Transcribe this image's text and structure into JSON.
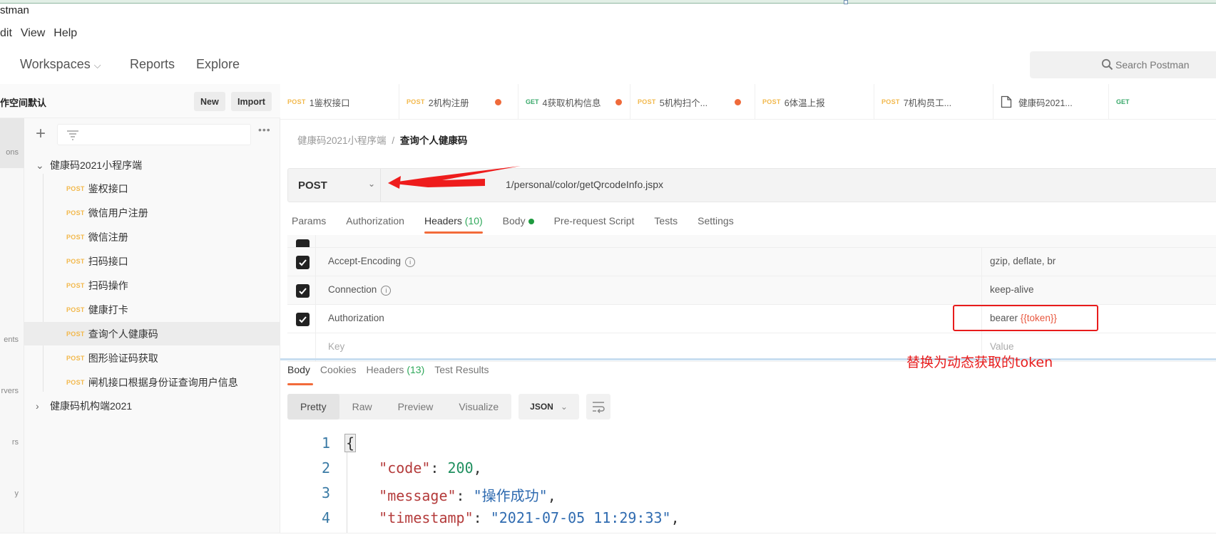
{
  "app": {
    "title_partial": "stman"
  },
  "menu": [
    "dit",
    "View",
    "Help"
  ],
  "nav": {
    "workspaces": "Workspaces",
    "reports": "Reports",
    "explore": "Explore"
  },
  "search": {
    "placeholder": "Search Postman"
  },
  "sidebar": {
    "workspace_name": "作空间默认",
    "new_label": "New",
    "import_label": "Import",
    "rail": [
      "ons",
      "ents",
      "rvers",
      "rs",
      "y"
    ],
    "collections": [
      {
        "name": "健康码2021小程序端",
        "expanded": true,
        "requests": [
          {
            "method": "POST",
            "name": "鉴权接口"
          },
          {
            "method": "POST",
            "name": "微信用户注册"
          },
          {
            "method": "POST",
            "name": "微信注册"
          },
          {
            "method": "POST",
            "name": "扫码接口"
          },
          {
            "method": "POST",
            "name": "扫码操作"
          },
          {
            "method": "POST",
            "name": "健康打卡"
          },
          {
            "method": "POST",
            "name": "查询个人健康码",
            "active": true
          },
          {
            "method": "POST",
            "name": "图形验证码获取"
          },
          {
            "method": "POST",
            "name": "闸机接口根据身份证查询用户信息"
          }
        ]
      },
      {
        "name": "健康码机构端2021",
        "expanded": false
      }
    ]
  },
  "tabs": [
    {
      "method": "POST",
      "name": "1鉴权接口",
      "unsaved": false
    },
    {
      "method": "POST",
      "name": "2机构注册",
      "unsaved": true
    },
    {
      "method": "GET",
      "name": "4获取机构信息",
      "unsaved": true
    },
    {
      "method": "POST",
      "name": "5机构扫个...",
      "unsaved": true
    },
    {
      "method": "POST",
      "name": "6体温上报",
      "unsaved": false
    },
    {
      "method": "POST",
      "name": "7机构员工...",
      "unsaved": false
    },
    {
      "method": "DOC",
      "name": "健康码2021...",
      "unsaved": false
    },
    {
      "method": "GET",
      "name": "",
      "unsaved": false
    }
  ],
  "breadcrumb": {
    "parent": "健康码2021小程序端",
    "separator": "/",
    "current": "查询个人健康码"
  },
  "request": {
    "method": "POST",
    "url_visible": "1/personal/color/getQrcodeInfo.jspx"
  },
  "request_tabs": [
    {
      "label": "Params"
    },
    {
      "label": "Authorization"
    },
    {
      "label": "Headers",
      "count": "(10)",
      "active": true
    },
    {
      "label": "Body",
      "dot": true
    },
    {
      "label": "Pre-request Script"
    },
    {
      "label": "Tests"
    },
    {
      "label": "Settings"
    }
  ],
  "headers": [
    {
      "key": "Accept-Encoding",
      "value": "gzip, deflate, br",
      "checked": true,
      "info": true
    },
    {
      "key": "Connection",
      "value": "keep-alive",
      "checked": true,
      "info": true
    },
    {
      "key": "Authorization",
      "value_prefix": "bearer ",
      "value_var": "{{token}}",
      "checked": true,
      "info": false
    }
  ],
  "new_header": {
    "key_placeholder": "Key",
    "value_placeholder": "Value"
  },
  "annotation": "替换为动态获取的token",
  "response_tabs": [
    {
      "label": "Body",
      "active": true
    },
    {
      "label": "Cookies"
    },
    {
      "label": "Headers",
      "count": "(13)"
    },
    {
      "label": "Test Results"
    }
  ],
  "view_modes": [
    "Pretty",
    "Raw",
    "Preview",
    "Visualize"
  ],
  "format": "JSON",
  "response_body": [
    {
      "line": "1",
      "text": "{"
    },
    {
      "line": "2",
      "key": "\"code\"",
      "value": "200",
      "type": "number"
    },
    {
      "line": "3",
      "key": "\"message\"",
      "value": "\"操作成功\"",
      "type": "string"
    },
    {
      "line": "4",
      "key": "\"timestamp\"",
      "value": "\"2021-07-05 11:29:33\"",
      "type": "string"
    }
  ]
}
